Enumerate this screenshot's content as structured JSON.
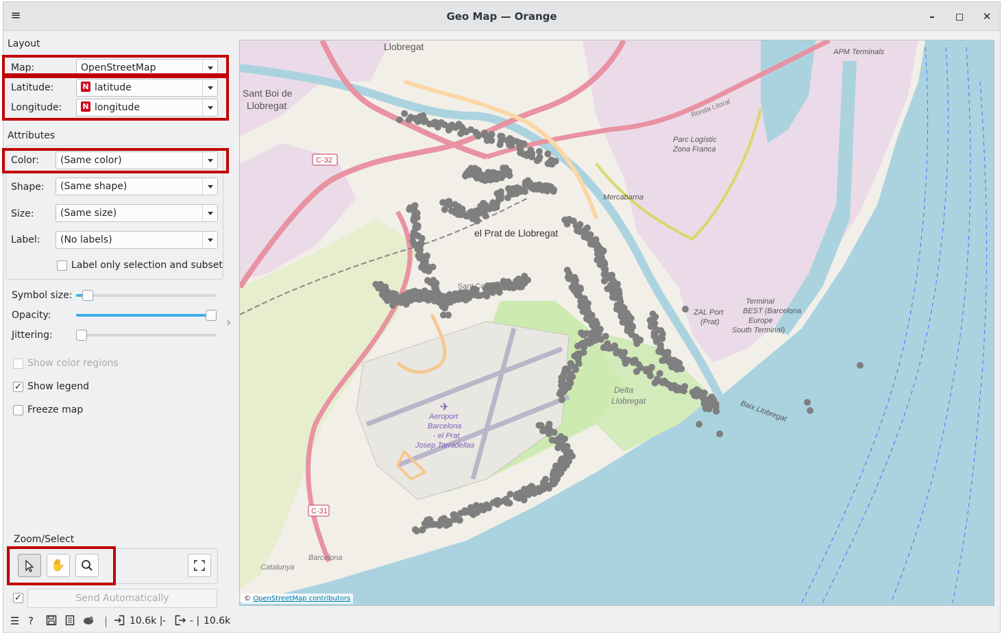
{
  "window": {
    "title": "Geo Map — Orange",
    "minimize": "–",
    "maximize": "◻",
    "close": "✕",
    "menu_icon": "≡"
  },
  "layout": {
    "section_title": "Layout",
    "map": {
      "label": "Map:",
      "value": "OpenStreetMap"
    },
    "latitude": {
      "label": "Latitude:",
      "value": "latitude",
      "badge": "N"
    },
    "longitude": {
      "label": "Longitude:",
      "value": "longitude",
      "badge": "N"
    }
  },
  "attributes": {
    "section_title": "Attributes",
    "color": {
      "label": "Color:",
      "value": "(Same color)"
    },
    "shape": {
      "label": "Shape:",
      "value": "(Same shape)"
    },
    "size": {
      "label": "Size:",
      "value": "(Same size)"
    },
    "label": {
      "label": "Label:",
      "value": "(No labels)"
    },
    "label_only_selection": {
      "label": "Label only selection and subset",
      "checked": false
    }
  },
  "sliders": {
    "symbol_size": {
      "label": "Symbol size:",
      "value_fraction": 0.05
    },
    "opacity": {
      "label": "Opacity:",
      "value_fraction": 1.0
    },
    "jittering": {
      "label": "Jittering:",
      "value_fraction": 0.0
    }
  },
  "options": {
    "show_color_regions": {
      "label": "Show color regions",
      "checked": false,
      "enabled": false
    },
    "show_legend": {
      "label": "Show legend",
      "checked": true
    },
    "freeze_map": {
      "label": "Freeze map",
      "checked": false
    }
  },
  "zoom_select": {
    "title": "Zoom/Select",
    "active_tool": "select"
  },
  "send": {
    "checked": true,
    "label": "Send Automatically"
  },
  "status": {
    "input_count": "10.6k |",
    "input_sep": "-",
    "output_prefix": "- |",
    "output_count": "10.6k"
  },
  "map": {
    "attribution_prefix": "©",
    "attribution_link": "OpenStreetMap contributors",
    "place_labels": [
      "Llobregat",
      "Sant Boi de",
      "Llobregat",
      "el Prat de Llobregat",
      "Mercabarna",
      "Parc Logístic",
      "Zona Franca",
      "APM Terminals",
      "ZAL Port",
      "(Prat)",
      "Terminal",
      "BEST (Barcelona",
      "Europe",
      "South Terminal)",
      "Aeroport",
      "Barcelona",
      "- el Prat",
      "Josep Tarradellas",
      "Delta",
      "Llobregat",
      "Barcelona",
      "Catalunya",
      "Baix Llobregat",
      "Ronda Litoral",
      "Sant Cosme"
    ],
    "road_badges": [
      "C-32",
      "C-31"
    ],
    "colors": {
      "sea": "#aad3df",
      "land": "#f2efe9",
      "industrial": "#ebdbe8",
      "motorway": "#e892a2",
      "primary": "#fcd6a4",
      "park": "#cdebb0",
      "points": "#7f7f7f"
    }
  }
}
